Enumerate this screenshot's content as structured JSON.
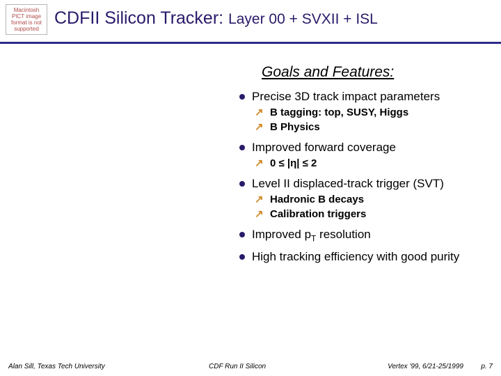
{
  "placeholder_text": "Macintosh PICT image format is not supported",
  "title_main": "CDFII Silicon Tracker: ",
  "title_sub": "Layer 00 + SVXII + ISL",
  "goals_header": "Goals and Features:",
  "bullets": {
    "b1": "Precise 3D track impact parameters",
    "b1_sub1": "B tagging: top, SUSY, Higgs",
    "b1_sub2": "B Physics",
    "b2": "Improved forward coverage",
    "b2_sub1": "0 ≤ |η| ≤  2",
    "b3": "Level II displaced-track trigger (SVT)",
    "b3_sub1": "Hadronic B decays",
    "b3_sub2": "Calibration triggers",
    "b4_pre": "Improved p",
    "b4_subscript": "T",
    "b4_post": " resolution",
    "b5": "High tracking efficiency with good purity"
  },
  "footer": {
    "left": "Alan Sill, Texas Tech University",
    "center": "CDF Run II Silicon",
    "right": "Vertex '99, 6/21-25/1999",
    "page": "p. 7"
  }
}
